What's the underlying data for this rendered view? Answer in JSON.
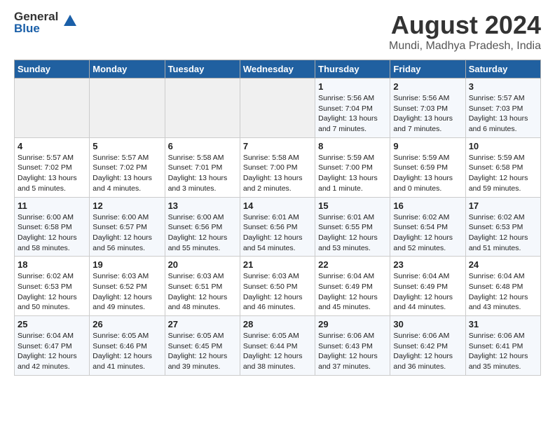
{
  "header": {
    "logo_general": "General",
    "logo_blue": "Blue",
    "month_year": "August 2024",
    "location": "Mundi, Madhya Pradesh, India"
  },
  "weekdays": [
    "Sunday",
    "Monday",
    "Tuesday",
    "Wednesday",
    "Thursday",
    "Friday",
    "Saturday"
  ],
  "weeks": [
    [
      {
        "day": "",
        "info": ""
      },
      {
        "day": "",
        "info": ""
      },
      {
        "day": "",
        "info": ""
      },
      {
        "day": "",
        "info": ""
      },
      {
        "day": "1",
        "info": "Sunrise: 5:56 AM\nSunset: 7:04 PM\nDaylight: 13 hours\nand 7 minutes."
      },
      {
        "day": "2",
        "info": "Sunrise: 5:56 AM\nSunset: 7:03 PM\nDaylight: 13 hours\nand 7 minutes."
      },
      {
        "day": "3",
        "info": "Sunrise: 5:57 AM\nSunset: 7:03 PM\nDaylight: 13 hours\nand 6 minutes."
      }
    ],
    [
      {
        "day": "4",
        "info": "Sunrise: 5:57 AM\nSunset: 7:02 PM\nDaylight: 13 hours\nand 5 minutes."
      },
      {
        "day": "5",
        "info": "Sunrise: 5:57 AM\nSunset: 7:02 PM\nDaylight: 13 hours\nand 4 minutes."
      },
      {
        "day": "6",
        "info": "Sunrise: 5:58 AM\nSunset: 7:01 PM\nDaylight: 13 hours\nand 3 minutes."
      },
      {
        "day": "7",
        "info": "Sunrise: 5:58 AM\nSunset: 7:00 PM\nDaylight: 13 hours\nand 2 minutes."
      },
      {
        "day": "8",
        "info": "Sunrise: 5:59 AM\nSunset: 7:00 PM\nDaylight: 13 hours\nand 1 minute."
      },
      {
        "day": "9",
        "info": "Sunrise: 5:59 AM\nSunset: 6:59 PM\nDaylight: 13 hours\nand 0 minutes."
      },
      {
        "day": "10",
        "info": "Sunrise: 5:59 AM\nSunset: 6:58 PM\nDaylight: 12 hours\nand 59 minutes."
      }
    ],
    [
      {
        "day": "11",
        "info": "Sunrise: 6:00 AM\nSunset: 6:58 PM\nDaylight: 12 hours\nand 58 minutes."
      },
      {
        "day": "12",
        "info": "Sunrise: 6:00 AM\nSunset: 6:57 PM\nDaylight: 12 hours\nand 56 minutes."
      },
      {
        "day": "13",
        "info": "Sunrise: 6:00 AM\nSunset: 6:56 PM\nDaylight: 12 hours\nand 55 minutes."
      },
      {
        "day": "14",
        "info": "Sunrise: 6:01 AM\nSunset: 6:56 PM\nDaylight: 12 hours\nand 54 minutes."
      },
      {
        "day": "15",
        "info": "Sunrise: 6:01 AM\nSunset: 6:55 PM\nDaylight: 12 hours\nand 53 minutes."
      },
      {
        "day": "16",
        "info": "Sunrise: 6:02 AM\nSunset: 6:54 PM\nDaylight: 12 hours\nand 52 minutes."
      },
      {
        "day": "17",
        "info": "Sunrise: 6:02 AM\nSunset: 6:53 PM\nDaylight: 12 hours\nand 51 minutes."
      }
    ],
    [
      {
        "day": "18",
        "info": "Sunrise: 6:02 AM\nSunset: 6:53 PM\nDaylight: 12 hours\nand 50 minutes."
      },
      {
        "day": "19",
        "info": "Sunrise: 6:03 AM\nSunset: 6:52 PM\nDaylight: 12 hours\nand 49 minutes."
      },
      {
        "day": "20",
        "info": "Sunrise: 6:03 AM\nSunset: 6:51 PM\nDaylight: 12 hours\nand 48 minutes."
      },
      {
        "day": "21",
        "info": "Sunrise: 6:03 AM\nSunset: 6:50 PM\nDaylight: 12 hours\nand 46 minutes."
      },
      {
        "day": "22",
        "info": "Sunrise: 6:04 AM\nSunset: 6:49 PM\nDaylight: 12 hours\nand 45 minutes."
      },
      {
        "day": "23",
        "info": "Sunrise: 6:04 AM\nSunset: 6:49 PM\nDaylight: 12 hours\nand 44 minutes."
      },
      {
        "day": "24",
        "info": "Sunrise: 6:04 AM\nSunset: 6:48 PM\nDaylight: 12 hours\nand 43 minutes."
      }
    ],
    [
      {
        "day": "25",
        "info": "Sunrise: 6:04 AM\nSunset: 6:47 PM\nDaylight: 12 hours\nand 42 minutes."
      },
      {
        "day": "26",
        "info": "Sunrise: 6:05 AM\nSunset: 6:46 PM\nDaylight: 12 hours\nand 41 minutes."
      },
      {
        "day": "27",
        "info": "Sunrise: 6:05 AM\nSunset: 6:45 PM\nDaylight: 12 hours\nand 39 minutes."
      },
      {
        "day": "28",
        "info": "Sunrise: 6:05 AM\nSunset: 6:44 PM\nDaylight: 12 hours\nand 38 minutes."
      },
      {
        "day": "29",
        "info": "Sunrise: 6:06 AM\nSunset: 6:43 PM\nDaylight: 12 hours\nand 37 minutes."
      },
      {
        "day": "30",
        "info": "Sunrise: 6:06 AM\nSunset: 6:42 PM\nDaylight: 12 hours\nand 36 minutes."
      },
      {
        "day": "31",
        "info": "Sunrise: 6:06 AM\nSunset: 6:41 PM\nDaylight: 12 hours\nand 35 minutes."
      }
    ]
  ]
}
